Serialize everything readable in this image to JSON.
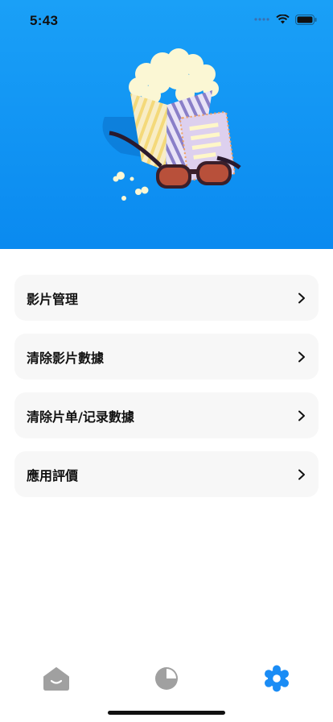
{
  "status_bar": {
    "time": "5:43"
  },
  "menu": {
    "items": [
      {
        "label": "影片管理"
      },
      {
        "label": "清除影片數據"
      },
      {
        "label": "清除片单/记录數據"
      },
      {
        "label": "應用評價"
      }
    ]
  },
  "tabbar": {
    "items": [
      {
        "icon": "home-icon",
        "active": false
      },
      {
        "icon": "pie-chart-icon",
        "active": false
      },
      {
        "icon": "gear-icon",
        "active": true
      }
    ],
    "active_color": "#1a8cf5",
    "inactive_color": "#a0a0a0"
  },
  "colors": {
    "hero_top": "#1aa0f7",
    "hero_bottom": "#0a8af0",
    "card_bg": "#f7f7f7"
  }
}
